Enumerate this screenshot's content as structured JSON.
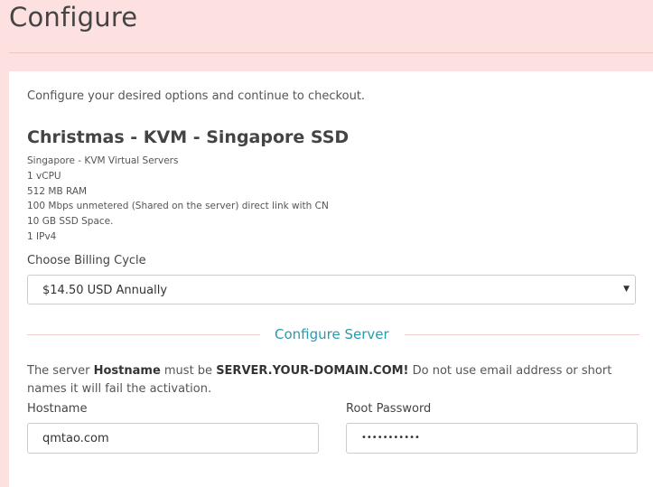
{
  "page_title": "Configure",
  "intro": "Configure your desired options and continue to checkout.",
  "product": {
    "name": "Christmas - KVM - Singapore SSD",
    "details": [
      "Singapore - KVM Virtual Servers",
      "1 vCPU",
      "512 MB RAM",
      "100 Mbps unmetered (Shared on the server) direct link with CN",
      "10 GB SSD Space.",
      "1 IPv4"
    ]
  },
  "billing": {
    "label": "Choose Billing Cycle",
    "selected": "$14.50 USD Annually"
  },
  "configure_server": {
    "heading": "Configure Server",
    "note": {
      "p1": "The server ",
      "b1": "Hostname",
      "p2": " must be ",
      "b2": "SERVER.YOUR-DOMAIN.COM!",
      "p3": " Do not use email address or short names it will fail the activation."
    },
    "hostname_label": "Hostname",
    "hostname_value": "qmtao.com",
    "password_label": "Root Password",
    "password_value": "•••••••••••"
  },
  "colors": {
    "background": "#fde0e0",
    "accent": "#2a9aaa"
  }
}
